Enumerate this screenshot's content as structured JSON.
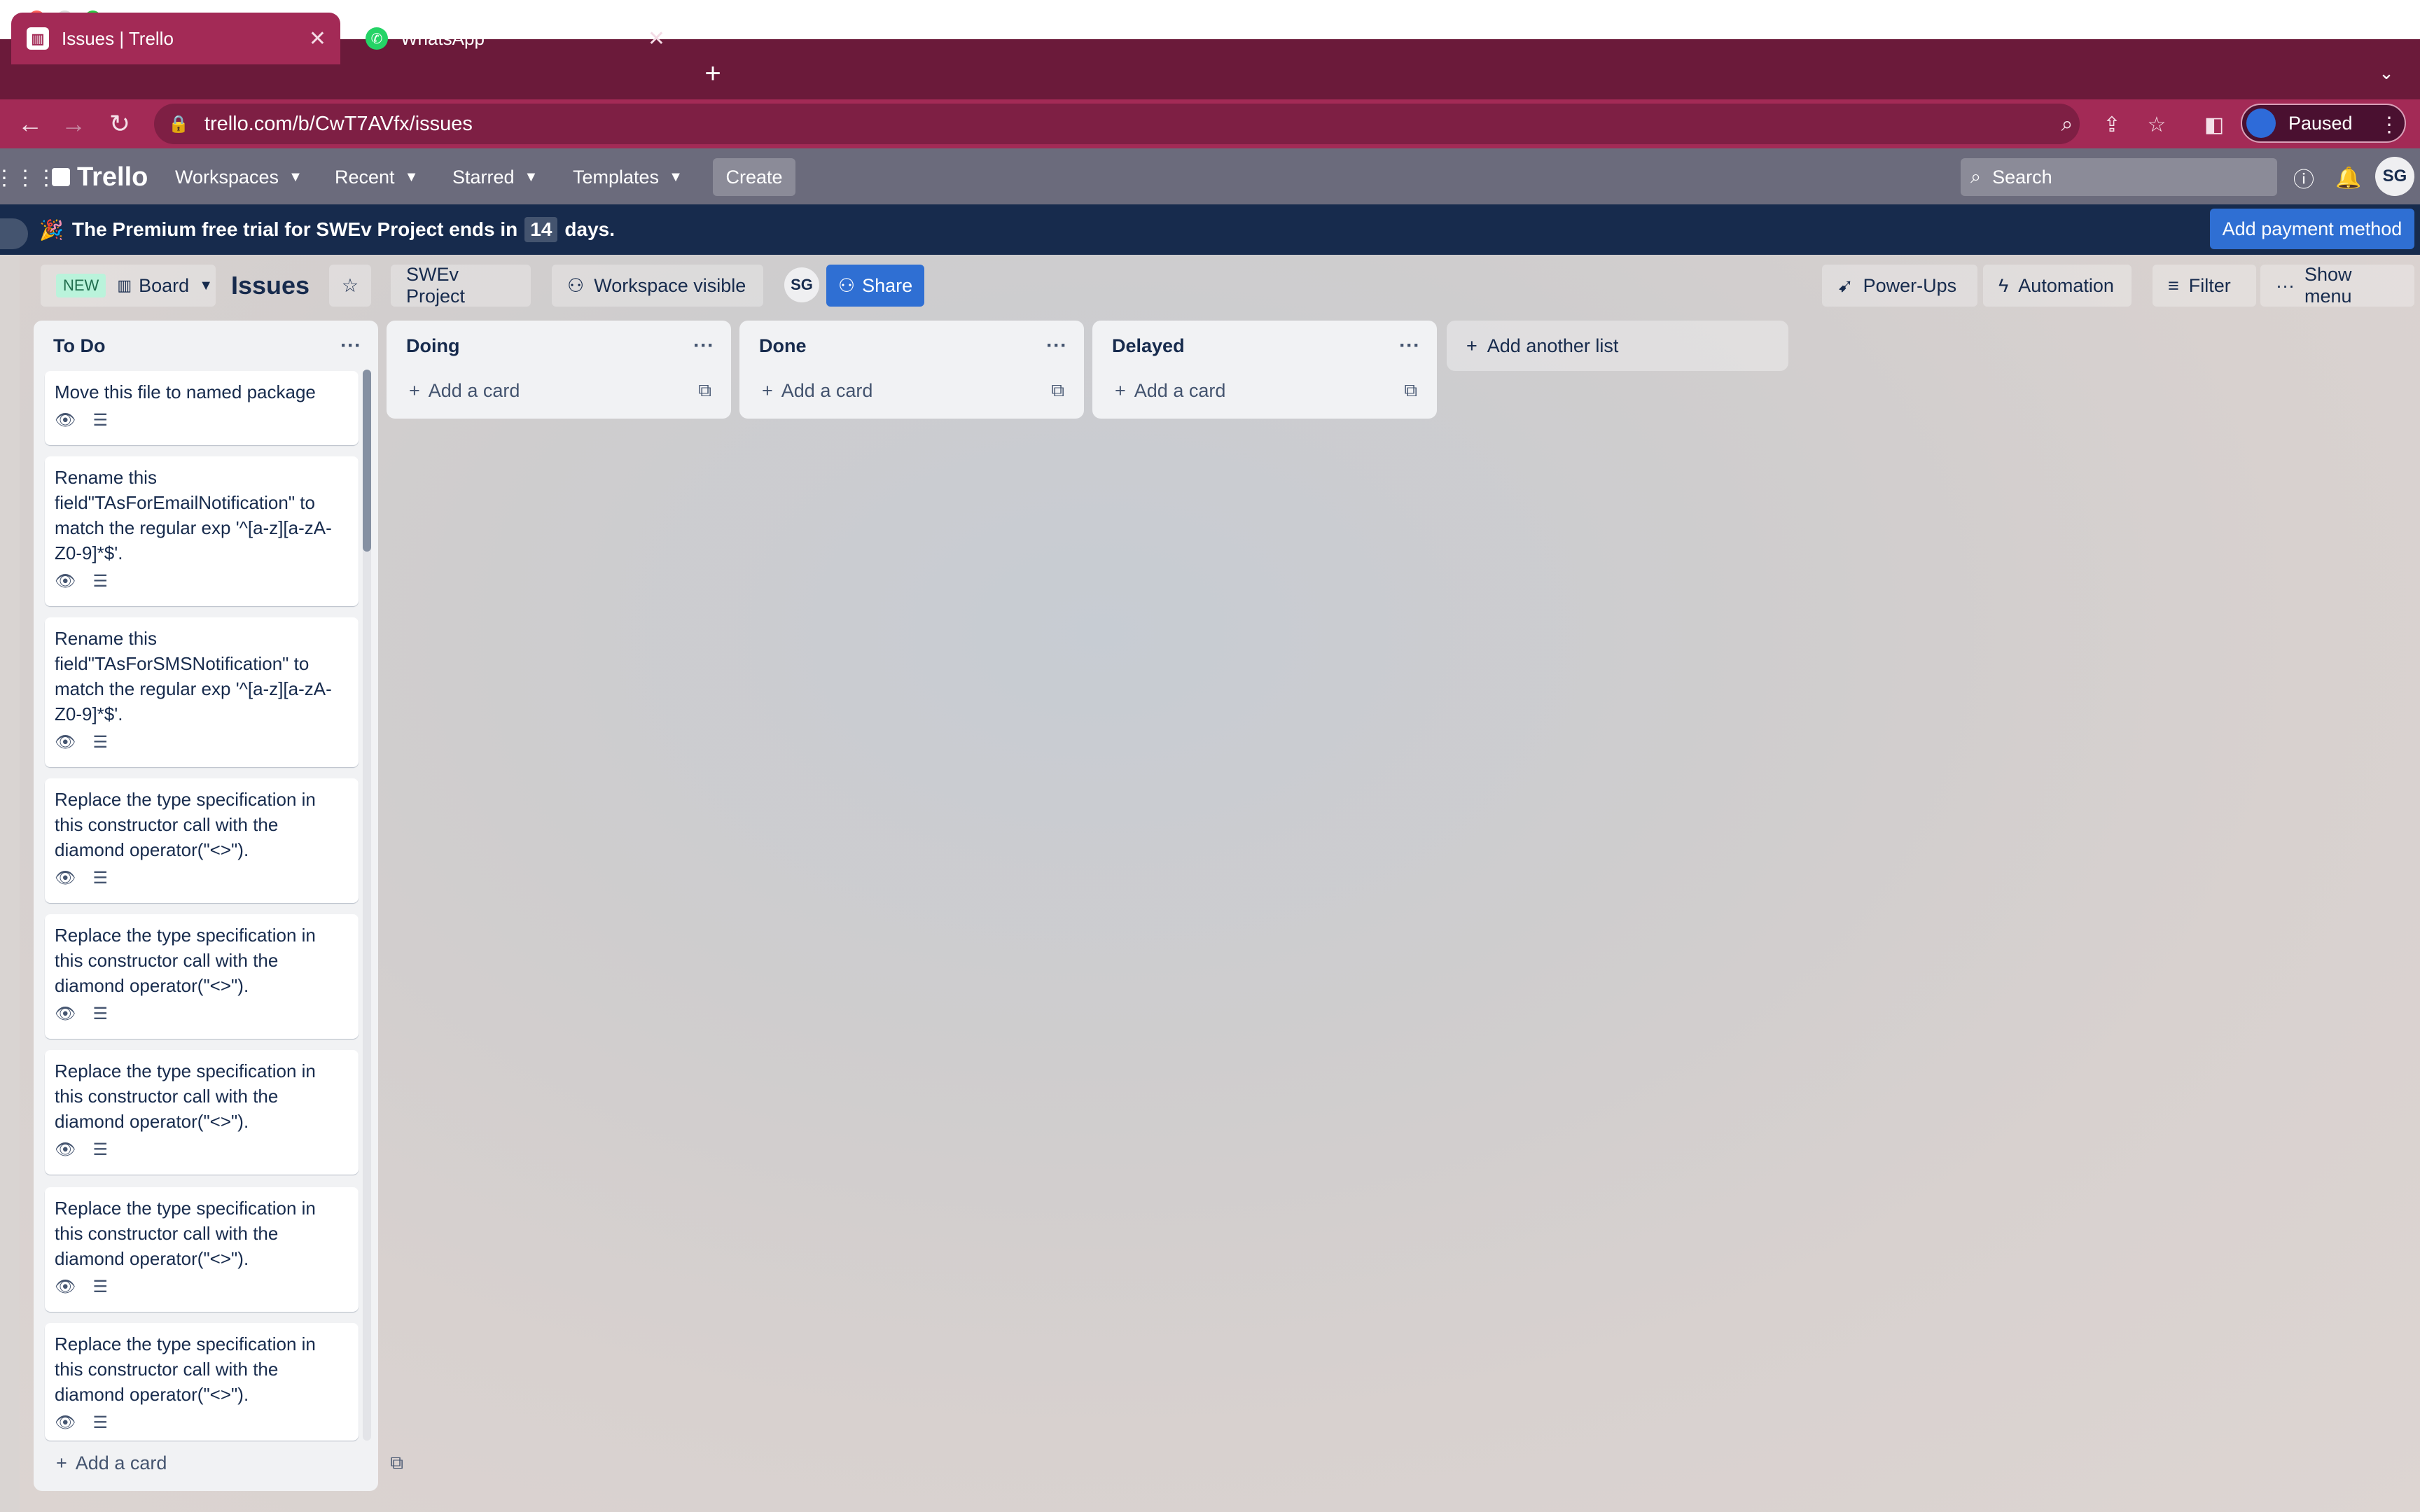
{
  "browser": {
    "tabs": [
      {
        "title": "Issues | Trello",
        "active": true
      },
      {
        "title": "WhatsApp",
        "active": false
      }
    ],
    "new_tab": "+",
    "url": "trello.com/b/CwT7AVfx/issues",
    "profile_status": "Paused"
  },
  "header": {
    "logo": "Trello",
    "menus": [
      "Workspaces",
      "Recent",
      "Starred",
      "Templates"
    ],
    "create_label": "Create",
    "search_placeholder": "Search",
    "avatar_initials": "SG"
  },
  "banner": {
    "emoji": "🎉",
    "text_before": "The Premium free trial for SWEv Project ends in",
    "days": "14",
    "text_after": "days.",
    "action": "Add payment method"
  },
  "board": {
    "new_badge": "NEW",
    "view": "Board",
    "title": "Issues",
    "workspace": "SWEv Project",
    "visibility": "Workspace visible",
    "member_initials": "SG",
    "share": "Share",
    "power_ups": "Power-Ups",
    "automation": "Automation",
    "filter": "Filter",
    "show_menu": "Show menu"
  },
  "lists": [
    {
      "name": "To Do",
      "add_card": "Add a card",
      "cards": [
        "Move this file to named package",
        "Rename this field\"TAsForEmailNotification\" to match the regular exp '^[a-z][a-zA-Z0-9]*$'.",
        "Rename this field\"TAsForSMSNotification\" to match the regular exp '^[a-z][a-zA-Z0-9]*$'.",
        "Replace the type specification in this constructor call with the diamond operator(\"<>\").",
        "Replace the type specification in this constructor call with the diamond operator(\"<>\").",
        "Replace the type specification in this constructor call with the diamond operator(\"<>\").",
        "Replace the type specification in this constructor call with the diamond operator(\"<>\").",
        "Replace the type specification in this constructor call with the diamond operator(\"<>\")."
      ]
    },
    {
      "name": "Doing",
      "add_card": "Add a card",
      "cards": []
    },
    {
      "name": "Done",
      "add_card": "Add a card",
      "cards": []
    },
    {
      "name": "Delayed",
      "add_card": "Add a card",
      "cards": []
    }
  ],
  "add_another_list": "Add another list",
  "colors": {
    "tab_strip": "#6b1a3a",
    "active_tab": "#a32a56",
    "trello_header": "#6b6b7c",
    "banner": "#172b4d",
    "primary_button": "#2f6fd3"
  }
}
